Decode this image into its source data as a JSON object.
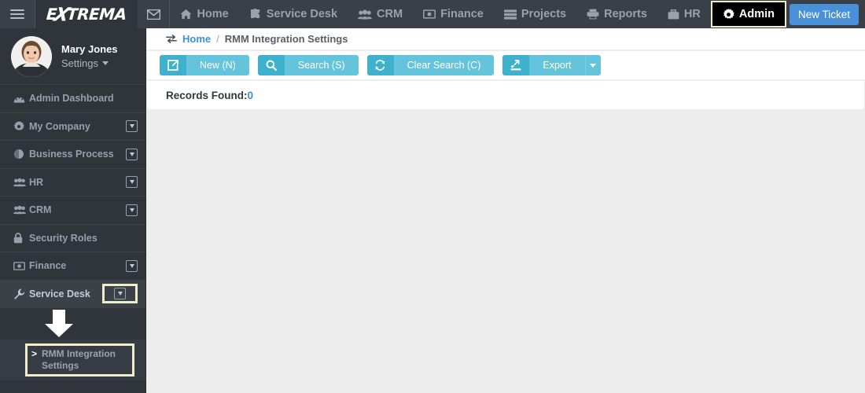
{
  "topbar": {
    "hamburger": "menu-icon",
    "brand": {
      "prefix": "E",
      "bolt": "X",
      "suffix": "TREMA"
    },
    "mail_icon": "envelope-icon",
    "nav_items": [
      {
        "label": "Home",
        "icon": "house-icon",
        "active": false
      },
      {
        "label": "Service Desk",
        "icon": "puzzle-piece-icon",
        "active": false
      },
      {
        "label": "CRM",
        "icon": "users-icon",
        "active": false
      },
      {
        "label": "Finance",
        "icon": "money-bill-icon",
        "active": false
      },
      {
        "label": "Projects",
        "icon": "server-stack-icon",
        "active": false
      },
      {
        "label": "Reports",
        "icon": "printer-icon",
        "active": false
      },
      {
        "label": "HR",
        "icon": "briefcase-icon",
        "active": false
      },
      {
        "label": "Admin",
        "icon": "gear-icon",
        "active": true
      }
    ],
    "new_ticket_label": "New Ticket"
  },
  "sidebar": {
    "user": {
      "name": "Mary Jones",
      "settings_label": "Settings",
      "avatar": "user-photo-avatar"
    },
    "items": [
      {
        "label": "Admin Dashboard",
        "icon": "dashboard-icon",
        "expandable": false,
        "active": false
      },
      {
        "label": "My Company",
        "icon": "gear-icon",
        "expandable": true,
        "active": false
      },
      {
        "label": "Business Process",
        "icon": "globe-icon",
        "expandable": true,
        "active": false
      },
      {
        "label": "HR",
        "icon": "users-icon",
        "expandable": true,
        "active": false
      },
      {
        "label": "CRM",
        "icon": "users-icon",
        "expandable": true,
        "active": false
      },
      {
        "label": "Security Roles",
        "icon": "lock-icon",
        "expandable": false,
        "active": false
      },
      {
        "label": "Finance",
        "icon": "money-bill-icon",
        "expandable": true,
        "active": false
      },
      {
        "label": "Service Desk",
        "icon": "wrench-icon",
        "expandable": true,
        "active": true,
        "highlighted_expander": true
      }
    ],
    "submenu": {
      "chevron": ">",
      "label": "RMM Integration Settings",
      "highlighted": true
    },
    "annotation_arrow": "down-arrow-annotation"
  },
  "main": {
    "breadcrumb": {
      "icon": "exchange-arrows-icon",
      "home": "Home",
      "separator": "/",
      "current": "RMM Integration Settings"
    },
    "toolbar": [
      {
        "label": "New (N)",
        "icon": "external-link-icon",
        "has_caret": false
      },
      {
        "label": "Search (S)",
        "icon": "search-icon",
        "has_caret": false
      },
      {
        "label": "Clear Search (C)",
        "icon": "refresh-icon",
        "has_caret": false
      },
      {
        "label": "Export",
        "icon": "export-icon",
        "has_caret": true
      }
    ],
    "records": {
      "label": "Records Found:",
      "value": "0"
    }
  },
  "colors": {
    "topbar_bg": "#3a4047",
    "brand_bg": "#2f353b",
    "sidebar_bg": "#2f353b",
    "accent_teal": "#3eb1cd",
    "accent_teal_light": "#64c4dc",
    "link_blue": "#3a8fd9",
    "highlight_border": "#f2ecc9",
    "page_bg": "#ededed"
  }
}
